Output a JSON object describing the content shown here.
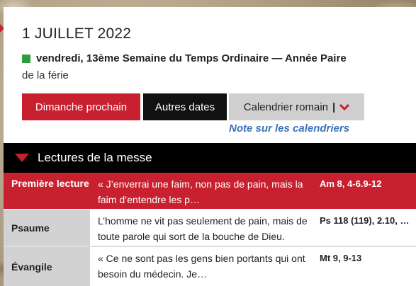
{
  "header": {
    "date": "1 JUILLET 2022",
    "day_line": "vendredi, 13ème Semaine du Temps Ordinaire — Année Paire",
    "ferie": "de la férie",
    "liturgical_color": "#2f9c3e"
  },
  "buttons": {
    "dimanche": "Dimanche prochain",
    "autres": "Autres dates",
    "calendrier": "Calendrier romain",
    "calendrier_sep": "|"
  },
  "note_link": "Note sur les calendriers",
  "section": {
    "title": "Lectures de la messe"
  },
  "readings": [
    {
      "label": "Première lecture",
      "text": "« J’enverrai une faim, non pas de pain, mais la faim d’entendre les p…",
      "ref": "Am 8, 4-6.9-12"
    },
    {
      "label": "Psaume",
      "text": "L’homme ne vit pas seulement de pain, mais de toute parole qui sort de la bouche de Dieu.",
      "ref": "Ps 118 (119), 2.10, …"
    },
    {
      "label": "Évangile",
      "text": "« Ce ne sont pas les gens bien portants qui ont besoin du médecin. Je…",
      "ref": "Mt 9, 9-13"
    }
  ],
  "colors": {
    "accent_red": "#c8202f",
    "link_blue": "#3b73b9",
    "dark": "#111111"
  }
}
